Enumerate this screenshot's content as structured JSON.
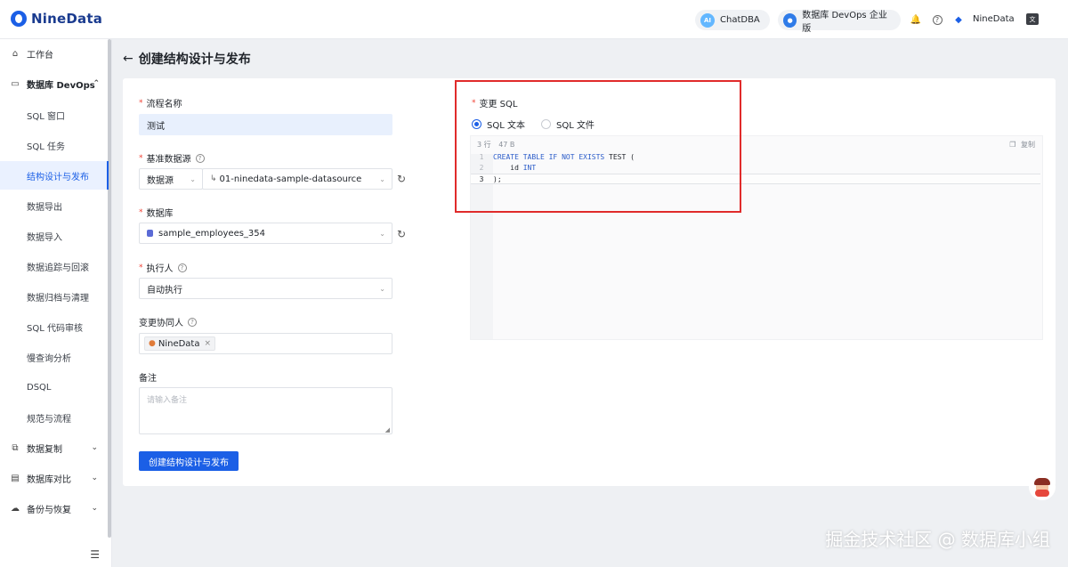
{
  "app": {
    "logo_text": "NineData"
  },
  "topbar": {
    "chatdba_label": "ChatDBA",
    "chatdba_icon_text": "AI",
    "edition_label": "数据库 DevOps 企业版",
    "user_label": "NineData"
  },
  "sidebar": {
    "items": [
      {
        "label": "工作台",
        "icon": "home-icon"
      },
      {
        "label": "数据库 DevOps",
        "icon": "devops-icon",
        "expanded": true
      },
      {
        "label": "SQL 窗口"
      },
      {
        "label": "SQL 任务"
      },
      {
        "label": "结构设计与发布",
        "active": true
      },
      {
        "label": "数据导出"
      },
      {
        "label": "数据导入"
      },
      {
        "label": "数据追踪与回滚"
      },
      {
        "label": "数据归档与清理"
      },
      {
        "label": "SQL 代码审核"
      },
      {
        "label": "慢查询分析"
      },
      {
        "label": "DSQL"
      },
      {
        "label": "规范与流程"
      },
      {
        "label": "数据复制",
        "icon": "replication-icon"
      },
      {
        "label": "数据库对比",
        "icon": "compare-icon"
      },
      {
        "label": "备份与恢复",
        "icon": "backup-icon"
      }
    ]
  },
  "page": {
    "title": "创建结构设计与发布"
  },
  "form": {
    "process_name_label": "流程名称",
    "process_name_value": "测试",
    "datasource_label": "基准数据源",
    "datasource_type": "数据源",
    "datasource_value": "01-ninedata-sample-datasource",
    "database_label": "数据库",
    "database_value": "sample_employees_354",
    "executor_label": "执行人",
    "executor_value": "自动执行",
    "collaborator_label": "变更协同人",
    "collaborator_tag": "NineData",
    "remark_label": "备注",
    "remark_placeholder": "请输入备注",
    "submit_label": "创建结构设计与发布"
  },
  "sql": {
    "label": "变更 SQL",
    "option_text": "SQL 文本",
    "option_file": "SQL 文件",
    "selected": "SQL 文本",
    "meta_lines": "3 行",
    "meta_size": "47 B",
    "copy_label": "复制",
    "lines": [
      {
        "n": "1",
        "code": "CREATE TABLE IF NOT EXISTS TEST ("
      },
      {
        "n": "2",
        "code": "    id INT"
      },
      {
        "n": "3",
        "code": ");"
      }
    ]
  },
  "watermark": "掘金技术社区 @ 数据库小组"
}
